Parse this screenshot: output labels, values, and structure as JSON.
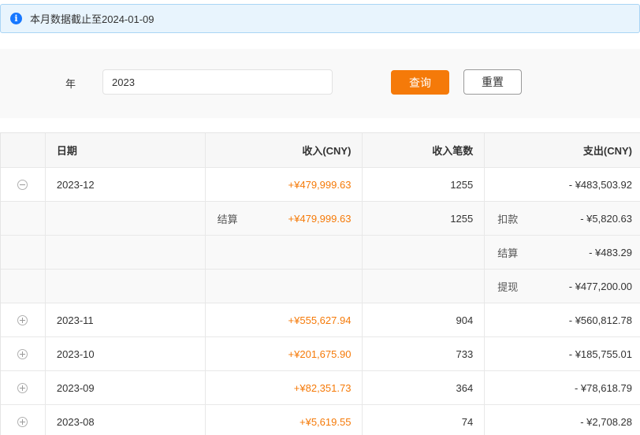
{
  "alert": {
    "text": "本月数据截止至2024-01-09"
  },
  "search": {
    "year_label": "年",
    "year_value": "2023",
    "query_label": "查询",
    "reset_label": "重置"
  },
  "table": {
    "headers": {
      "date": "日期",
      "income": "收入(CNY)",
      "count": "收入笔数",
      "expense": "支出(CNY)"
    },
    "rows": [
      {
        "date": "2023-12",
        "income": "+¥479,999.63",
        "count": "1255",
        "expense": "- ¥483,503.92",
        "expanded": true
      },
      {
        "date": "2023-11",
        "income": "+¥555,627.94",
        "count": "904",
        "expense": "- ¥560,812.78",
        "expanded": false
      },
      {
        "date": "2023-10",
        "income": "+¥201,675.90",
        "count": "733",
        "expense": "- ¥185,755.01",
        "expanded": false
      },
      {
        "date": "2023-09",
        "income": "+¥82,351.73",
        "count": "364",
        "expense": "- ¥78,618.79",
        "expanded": false
      },
      {
        "date": "2023-08",
        "income": "+¥5,619.55",
        "count": "74",
        "expense": "- ¥2,708.28",
        "expanded": false
      }
    ],
    "detail": [
      {
        "income_type": "结算",
        "income": "+¥479,999.63",
        "count": "1255",
        "expense_type": "扣款",
        "expense": "- ¥5,820.63"
      },
      {
        "income_type": "",
        "income": "",
        "count": "",
        "expense_type": "结算",
        "expense": "- ¥483.29"
      },
      {
        "income_type": "",
        "income": "",
        "count": "",
        "expense_type": "提现",
        "expense": "- ¥477,200.00"
      }
    ]
  },
  "colors": {
    "accent": "#f57a09",
    "info": "#1677ff",
    "alert_bg": "#e8f4fd"
  }
}
